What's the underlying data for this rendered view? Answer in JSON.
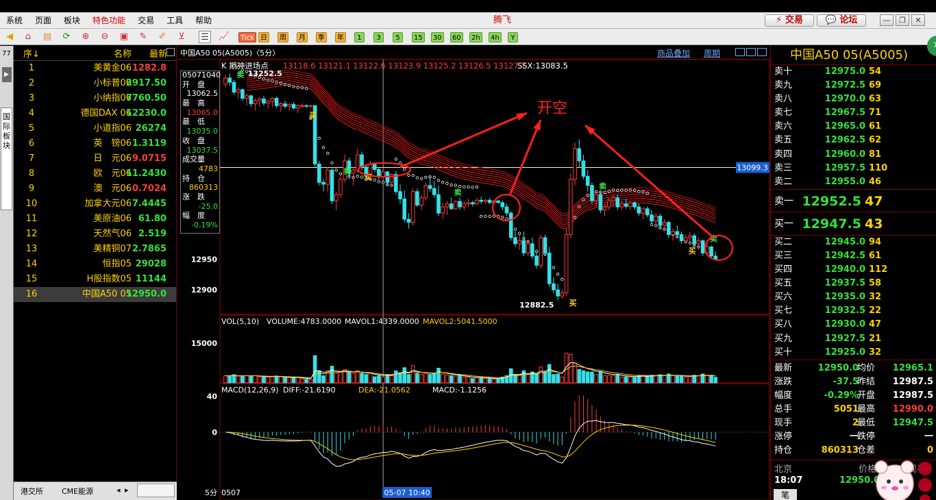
{
  "menu": {
    "items": [
      "系统",
      "页面",
      "板块",
      "特色功能",
      "交易",
      "工具",
      "帮助"
    ],
    "app_title": "腾飞",
    "trade_label": "交易",
    "forum_label": "论坛",
    "badge": "76"
  },
  "toolbar": {
    "periods": [
      "Tick",
      "日",
      "周",
      "月",
      "季",
      "年",
      "1",
      "3",
      "5",
      "15",
      "30",
      "60",
      "2h",
      "4h",
      "Y"
    ]
  },
  "sidebar": {
    "count": "77",
    "vertical_tab": "国际板块"
  },
  "quotelist": {
    "header": {
      "seq": "序↓",
      "name": "名称",
      "latest": "最新"
    },
    "rows": [
      {
        "idx": "1",
        "name": "美黄金06",
        "price": "1282.8",
        "dir": "up"
      },
      {
        "idx": "2",
        "name": "小标普06",
        "price": "2917.50",
        "dir": "down"
      },
      {
        "idx": "3",
        "name": "小纳指06",
        "price": "7760.50",
        "dir": "down"
      },
      {
        "idx": "4",
        "name": "德国DAX 06",
        "price": "12230.0",
        "dir": "down"
      },
      {
        "idx": "5",
        "name": "小道指06",
        "price": "26274",
        "dir": "down"
      },
      {
        "idx": "6",
        "name": "英　镑06",
        "price": "1.3119",
        "dir": "down"
      },
      {
        "idx": "7",
        "name": "日　元06",
        "price": "9.0715",
        "dir": "up"
      },
      {
        "idx": "8",
        "name": "欧　元06",
        "price": "11.2430",
        "dir": "down"
      },
      {
        "idx": "9",
        "name": "澳　元06",
        "price": "0.7024",
        "dir": "up"
      },
      {
        "idx": "10",
        "name": "加拿大元06",
        "price": "7.4445",
        "dir": "down"
      },
      {
        "idx": "11",
        "name": "美原油06",
        "price": "61.80",
        "dir": "down"
      },
      {
        "idx": "12",
        "name": "天然气06",
        "price": "2.519",
        "dir": "down"
      },
      {
        "idx": "13",
        "name": "美精铜07",
        "price": "2.7865",
        "dir": "down"
      },
      {
        "idx": "14",
        "name": "恒指05",
        "price": "29028",
        "dir": "down"
      },
      {
        "idx": "15",
        "name": "H股指数05",
        "price": "11144",
        "dir": "down"
      },
      {
        "idx": "16",
        "name": "中国A50 05",
        "price": "12950.0",
        "dir": "down"
      }
    ],
    "tabs": [
      "港交所",
      "CME能源"
    ]
  },
  "chart_header": {
    "title": "中国A50 05(A5005)〈5分〉",
    "overlay": "商品叠加",
    "period": "周期"
  },
  "infobox": {
    "date": "05071040",
    "open_label": "开　盘",
    "open": "13062.5",
    "high_label": "最　高",
    "high": "13065.0",
    "low_label": "最　低",
    "low": "13035.0",
    "close_label": "收　盘",
    "close": "13037.5",
    "vol_label": "成交量",
    "vol": "4783",
    "oi_label": "持　仓",
    "oi": "860313",
    "chg_label": "涨　跌",
    "chg": "-25.0",
    "pct_label": "幅　度",
    "pct": "-0.19%"
  },
  "chart_data": [
    {
      "type": "candlestick",
      "title": "K 期神进场点",
      "levels_header": "13118.6 13121.1 13122.6 13123.9 13125.2 13126.5 13127.7",
      "ssx_label": "SSX:13083.5",
      "y_ticks": [
        12950,
        12900
      ],
      "ylim": [
        12860,
        13275
      ],
      "price_tag": "13099.3",
      "hline": 13099.3,
      "high_label": "13252.5",
      "low_label": "12882.5",
      "annotation": "开空",
      "x_start": "0507",
      "x_cursor": "05-07 10:40",
      "period_label": "5分",
      "ohlc": [
        [
          13235,
          13250,
          13230,
          13245
        ],
        [
          13245,
          13252.5,
          13232,
          13238
        ],
        [
          13238,
          13242,
          13218,
          13222
        ],
        [
          13222,
          13230,
          13212,
          13226
        ],
        [
          13226,
          13228,
          13208,
          13212
        ],
        [
          13212,
          13220,
          13200,
          13216
        ],
        [
          13216,
          13218,
          13198,
          13203
        ],
        [
          13203,
          13212,
          13192,
          13208
        ],
        [
          13208,
          13214,
          13198,
          13211
        ],
        [
          13211,
          13216,
          13200,
          13204
        ],
        [
          13204,
          13210,
          13195,
          13207
        ],
        [
          13207,
          13214,
          13198,
          13212
        ],
        [
          13212,
          13215,
          13196,
          13200
        ],
        [
          13200,
          13206,
          13190,
          13203
        ],
        [
          13203,
          13208,
          13195,
          13199
        ],
        [
          13199,
          13204,
          13192,
          13202
        ],
        [
          13202,
          13206,
          13194,
          13196
        ],
        [
          13196,
          13202,
          13188,
          13200
        ],
        [
          13200,
          13204,
          13196,
          13200
        ],
        [
          13200,
          13202,
          13196,
          13199
        ],
        [
          13199,
          13201,
          13196,
          13200
        ],
        [
          13200,
          13200,
          13100,
          13105
        ],
        [
          13105,
          13110,
          13070,
          13075
        ],
        [
          13075,
          13080,
          13060,
          13072
        ],
        [
          13072,
          13100,
          13060,
          13095
        ],
        [
          13095,
          13098,
          13040,
          13045
        ],
        [
          13045,
          13060,
          13030,
          13055
        ],
        [
          13055,
          13085,
          13050,
          13080
        ],
        [
          13080,
          13120,
          13075,
          13110
        ],
        [
          13110,
          13115,
          13080,
          13090
        ],
        [
          13090,
          13100,
          13070,
          13095
        ],
        [
          13095,
          13130,
          13090,
          13120
        ],
        [
          13120,
          13125,
          13095,
          13100
        ],
        [
          13100,
          13105,
          13080,
          13085
        ],
        [
          13085,
          13110,
          13080,
          13105
        ],
        [
          13105,
          13108,
          13092,
          13096
        ],
        [
          13096,
          13100,
          13080,
          13084
        ],
        [
          13084,
          13095,
          13080,
          13092
        ],
        [
          13092,
          13094,
          13070,
          13075
        ],
        [
          13075,
          13090,
          13070,
          13088
        ],
        [
          13088,
          13094,
          13055,
          13060
        ],
        [
          13060,
          13072,
          13040,
          13048
        ],
        [
          13048,
          13062,
          13010,
          13015
        ],
        [
          13015,
          13025,
          13000,
          13010
        ],
        [
          13010,
          13065,
          13005,
          13060
        ],
        [
          13060,
          13065,
          13035,
          13038
        ],
        [
          13038,
          13055,
          13030,
          13050
        ],
        [
          13050,
          13075,
          13045,
          13070
        ],
        [
          13070,
          13085,
          13060,
          13065
        ],
        [
          13065,
          13078,
          13050,
          13055
        ],
        [
          13055,
          13070,
          13020,
          13025
        ],
        [
          13025,
          13042,
          13015,
          13035
        ],
        [
          13035,
          13045,
          13022,
          13040
        ],
        [
          13040,
          13050,
          13030,
          13032
        ],
        [
          13032,
          13046,
          13030,
          13044
        ],
        [
          13044,
          13050,
          13030,
          13035
        ],
        [
          13035,
          13045,
          13030,
          13040
        ],
        [
          13040,
          13048,
          13035,
          13042
        ],
        [
          13042,
          13045,
          13036,
          13040
        ],
        [
          13040,
          13050,
          13038,
          13046
        ],
        [
          13046,
          13052,
          13040,
          13044
        ],
        [
          13044,
          13048,
          13040,
          13046
        ],
        [
          13046,
          13050,
          13040,
          13042
        ],
        [
          13042,
          13046,
          13040,
          13045
        ],
        [
          13045,
          13046,
          13040,
          13042
        ],
        [
          13042,
          13045,
          13030,
          13035
        ],
        [
          13035,
          13040,
          13020,
          13025
        ],
        [
          13025,
          13028,
          12980,
          12985
        ],
        [
          12985,
          12995,
          12970,
          12975
        ],
        [
          12975,
          12990,
          12965,
          12980
        ],
        [
          12980,
          12995,
          12955,
          12960
        ],
        [
          12960,
          12980,
          12955,
          12975
        ],
        [
          12975,
          12985,
          12950,
          12955
        ],
        [
          12955,
          12962,
          12935,
          12940
        ],
        [
          12940,
          12990,
          12935,
          12985
        ],
        [
          12985,
          12990,
          12955,
          12960
        ],
        [
          12960,
          12970,
          12905,
          12910
        ],
        [
          12910,
          12920,
          12895,
          12900
        ],
        [
          12900,
          12910,
          12882.5,
          12890
        ],
        [
          12890,
          12900,
          12885,
          12895
        ],
        [
          12895,
          13000,
          12890,
          12990
        ],
        [
          12990,
          13090,
          12985,
          13080
        ],
        [
          13080,
          13140,
          13070,
          13130
        ],
        [
          13130,
          13145,
          13100,
          13110
        ],
        [
          13110,
          13120,
          13080,
          13085
        ],
        [
          13085,
          13095,
          13060,
          13070
        ],
        [
          13070,
          13075,
          13040,
          13045
        ],
        [
          13045,
          13060,
          13035,
          13055
        ],
        [
          13055,
          13060,
          13025,
          13030
        ],
        [
          13030,
          13040,
          13020,
          13035
        ],
        [
          13035,
          13050,
          13030,
          13045
        ],
        [
          13045,
          13055,
          13035,
          13050
        ],
        [
          13050,
          13055,
          13030,
          13035
        ],
        [
          13035,
          13045,
          13030,
          13040
        ],
        [
          13040,
          13048,
          13032,
          13036
        ],
        [
          13036,
          13045,
          13030,
          13042
        ],
        [
          13042,
          13044,
          13030,
          13035
        ],
        [
          13035,
          13040,
          13020,
          13025
        ],
        [
          13025,
          13035,
          13015,
          13032
        ],
        [
          13032,
          13036,
          13018,
          13022
        ],
        [
          13022,
          13030,
          13008,
          13012
        ],
        [
          13012,
          13025,
          13005,
          13020
        ],
        [
          13020,
          13024,
          13000,
          13005
        ],
        [
          13005,
          13015,
          12995,
          13010
        ],
        [
          13010,
          13012,
          12985,
          12990
        ],
        [
          12990,
          13000,
          12980,
          12995
        ],
        [
          12995,
          13005,
          12985,
          12990
        ],
        [
          12990,
          12995,
          12975,
          12980
        ],
        [
          12980,
          12990,
          12975,
          12985
        ],
        [
          12985,
          12995,
          12978,
          12988
        ],
        [
          12988,
          12992,
          12970,
          12975
        ],
        [
          12975,
          12985,
          12965,
          12980
        ],
        [
          12980,
          12982,
          12955,
          12960
        ],
        [
          12960,
          12975,
          12955,
          12970
        ],
        [
          12970,
          12972,
          12950,
          12955
        ],
        [
          12955,
          12962,
          12948,
          12950
        ]
      ],
      "signals": [
        {
          "i": 2,
          "label": "卖",
          "type": "sell"
        },
        {
          "i": 27,
          "label": "卖",
          "type": "sell"
        },
        {
          "i": 19,
          "label": "买",
          "type": "buy"
        },
        {
          "i": 32,
          "label": "买",
          "type": "buy"
        },
        {
          "i": 53,
          "label": "卖",
          "type": "sell"
        },
        {
          "i": 80,
          "label": "买",
          "type": "buy"
        },
        {
          "i": 87,
          "label": "卖",
          "type": "sell"
        },
        {
          "i": 108,
          "label": "买",
          "type": "buy"
        },
        {
          "i": 113,
          "label": "卖",
          "type": "sell"
        }
      ]
    },
    {
      "type": "bar",
      "title": "VOL(5,10)",
      "volume_label": "VOLUME:4783.0000",
      "mavol1_label": "MAVOL1:4339.0000",
      "mavol2_label": "MAVOL2:5041.5000",
      "y_ticks": [
        15000
      ],
      "ylim": [
        0,
        22000
      ]
    },
    {
      "type": "bar",
      "title": "MACD(12,26,9)",
      "diff_label": "DIFF:-21.6190",
      "dea_label": "DEA:-21.0562",
      "macd_label": "MACD:-1.1256",
      "y_ticks": [
        40,
        0
      ],
      "ylim": [
        -55,
        55
      ]
    }
  ],
  "orderbook": {
    "title": "中国A50 05(A5005)",
    "asks": [
      {
        "label": "卖十",
        "price": "12975.0",
        "qty": "54"
      },
      {
        "label": "卖九",
        "price": "12972.5",
        "qty": "69"
      },
      {
        "label": "卖八",
        "price": "12970.0",
        "qty": "63"
      },
      {
        "label": "卖七",
        "price": "12967.5",
        "qty": "71"
      },
      {
        "label": "卖六",
        "price": "12965.0",
        "qty": "61"
      },
      {
        "label": "卖五",
        "price": "12962.5",
        "qty": "62"
      },
      {
        "label": "卖四",
        "price": "12960.0",
        "qty": "81"
      },
      {
        "label": "卖三",
        "price": "12957.5",
        "qty": "110"
      },
      {
        "label": "卖二",
        "price": "12955.0",
        "qty": "46"
      }
    ],
    "best_ask": {
      "label": "卖一",
      "price": "12952.5",
      "qty": "47"
    },
    "best_bid": {
      "label": "买一",
      "price": "12947.5",
      "qty": "43"
    },
    "bids": [
      {
        "label": "买二",
        "price": "12945.0",
        "qty": "94"
      },
      {
        "label": "买三",
        "price": "12942.5",
        "qty": "61"
      },
      {
        "label": "买四",
        "price": "12940.0",
        "qty": "112"
      },
      {
        "label": "买五",
        "price": "12937.5",
        "qty": "58"
      },
      {
        "label": "买六",
        "price": "12935.0",
        "qty": "32"
      },
      {
        "label": "买七",
        "price": "12932.5",
        "qty": "22"
      },
      {
        "label": "买八",
        "price": "12930.0",
        "qty": "47"
      },
      {
        "label": "买九",
        "price": "12927.5",
        "qty": "21"
      },
      {
        "label": "买十",
        "price": "12925.0",
        "qty": "32"
      }
    ]
  },
  "stats": [
    {
      "l1": "最新",
      "v1": "12950.0",
      "c1": "down",
      "l2": "均价",
      "v2": "12965.1",
      "c2": "down"
    },
    {
      "l1": "涨跌",
      "v1": "-37.5",
      "c1": "down",
      "l2": "昨结",
      "v2": "12987.5",
      "c2": "wht"
    },
    {
      "l1": "幅度",
      "v1": "-0.29%",
      "c1": "down",
      "l2": "开盘",
      "v2": "12987.5",
      "c2": "wht"
    },
    {
      "l1": "总手",
      "v1": "5051",
      "c1": "yel",
      "l2": "最高",
      "v2": "12990.0",
      "c2": "up"
    },
    {
      "l1": "现手",
      "v1": "2",
      "c1": "yel",
      "l2": "最低",
      "v2": "12947.5",
      "c2": "down"
    },
    {
      "l1": "涨停",
      "v1": "一",
      "c1": "wht",
      "l2": "跌停",
      "v2": "一",
      "c2": "wht"
    },
    {
      "l1": "持仓",
      "v1": "860313",
      "c1": "yel",
      "l2": "仓差",
      "v2": "0",
      "c2": "yel"
    }
  ],
  "ticks": {
    "location": "北京",
    "price_header": "价格",
    "cur_header": "现手",
    "time": "18:07",
    "price": "12950.0",
    "tab": "笔"
  }
}
